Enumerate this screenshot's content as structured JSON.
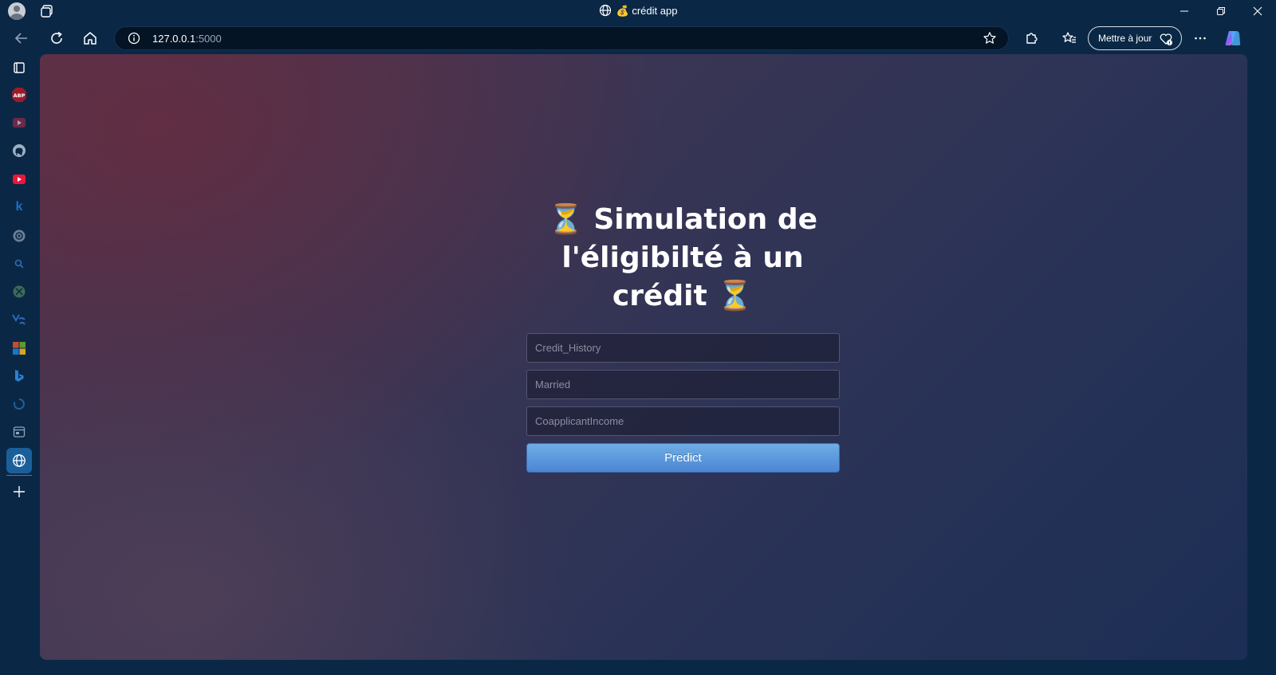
{
  "browser": {
    "tab_title": "💰 crédit app",
    "url_host": "127.0.0.1",
    "url_port": ":5000",
    "update_label": "Mettre à jour"
  },
  "sidebar": {
    "items": [
      {
        "icon": "collections-icon"
      },
      {
        "icon": "adblock-icon",
        "label": "ABP"
      },
      {
        "icon": "youtube-icon"
      },
      {
        "icon": "github-icon"
      },
      {
        "icon": "youtube-red-icon"
      },
      {
        "icon": "k-icon",
        "label": "k"
      },
      {
        "icon": "circle-app-icon"
      },
      {
        "icon": "search-icon"
      },
      {
        "icon": "xbox-icon"
      },
      {
        "icon": "app-icon"
      },
      {
        "icon": "microsoft-icon"
      },
      {
        "icon": "bing-icon"
      },
      {
        "icon": "loading-icon"
      },
      {
        "icon": "window-icon"
      },
      {
        "icon": "globe-icon"
      }
    ]
  },
  "page": {
    "title": "⏳ Simulation de l'éligibilté à un crédit ⏳",
    "fields": [
      {
        "name": "credit-history-input",
        "placeholder": "Credit_History"
      },
      {
        "name": "married-input",
        "placeholder": "Married"
      },
      {
        "name": "coapplicant-income-input",
        "placeholder": "CoapplicantIncome"
      }
    ],
    "predict_label": "Predict"
  },
  "colors": {
    "chrome": "#0a2846",
    "button": "#5a93dc"
  }
}
